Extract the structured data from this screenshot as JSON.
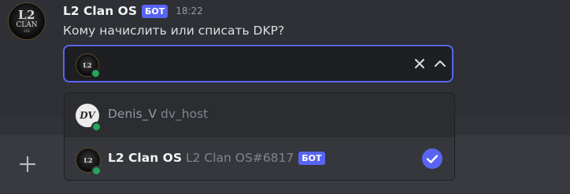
{
  "message": {
    "author": "L2 Clan OS",
    "bot_badge": "БОТ",
    "timestamp": "18:22",
    "text": "Кому начислить или списать DKP?",
    "avatar": {
      "line1": "L2",
      "line2": "CLAN",
      "line3": "OS"
    }
  },
  "select_menu": {
    "selected_avatar": "l2-clan-avatar",
    "clear_icon": "close-icon",
    "toggle_icon": "chevron-up-icon"
  },
  "options": [
    {
      "name": "Denis_V",
      "secondary": "dv_host",
      "avatar_text": "DV",
      "selected": false,
      "status": "online"
    },
    {
      "name": "L2 Clan OS",
      "secondary": "L2 Clan OS#6817",
      "badge": "БОТ",
      "selected": true,
      "status": "online"
    }
  ],
  "colors": {
    "accent": "#5865f2",
    "online": "#23a55a",
    "background": "#313338"
  },
  "chat_input": {
    "add_icon": "plus-icon"
  }
}
